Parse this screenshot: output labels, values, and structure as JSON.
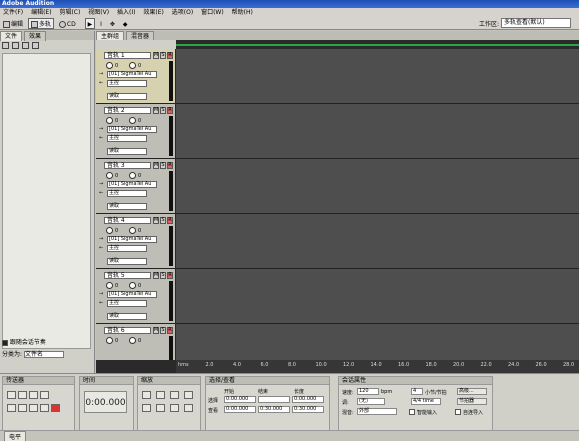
{
  "app": {
    "title": "Adobe Audition"
  },
  "menu": [
    "文件(F)",
    "编辑(E)",
    "剪辑(C)",
    "视图(V)",
    "插入(I)",
    "效果(E)",
    "选项(O)",
    "窗口(W)",
    "帮助(H)"
  ],
  "toolbar": {
    "edit": "编辑",
    "multitrack": "多轨",
    "cd": "CD",
    "workspace_label": "工作区:",
    "workspace_value": "多轨查看(默认)"
  },
  "left_tabs": [
    "文件",
    "效果"
  ],
  "left_footer": {
    "follow_label": "跟随会话节奏",
    "sortby_label": "分类为:",
    "sortby_value": "文件名"
  },
  "main_tabs": [
    "主群组",
    "混音器"
  ],
  "tracks": [
    {
      "name": "音轨 1",
      "vol": "0",
      "pan": "0",
      "input": "[01] SigmaTel Au",
      "output": "主控",
      "mode": "读取"
    },
    {
      "name": "音轨 2",
      "vol": "0",
      "pan": "0",
      "input": "[01] SigmaTel Au",
      "output": "主控",
      "mode": "读取"
    },
    {
      "name": "音轨 3",
      "vol": "0",
      "pan": "0",
      "input": "[01] SigmaTel Au",
      "output": "主控",
      "mode": "读取"
    },
    {
      "name": "音轨 4",
      "vol": "0",
      "pan": "0",
      "input": "[01] SigmaTel Au",
      "output": "主控",
      "mode": "读取"
    },
    {
      "name": "音轨 5",
      "vol": "0",
      "pan": "0",
      "input": "[01] SigmaTel Au",
      "output": "主控",
      "mode": "读取"
    },
    {
      "name": "音轨 6",
      "vol": "0",
      "pan": "0"
    }
  ],
  "ruler": [
    "hms",
    "2.0",
    "4.0",
    "6.0",
    "8.0",
    "10.0",
    "12.0",
    "14.0",
    "16.0",
    "18.0",
    "20.0",
    "22.0",
    "24.0",
    "26.0",
    "28.0"
  ],
  "transport": {
    "title": "传送器"
  },
  "time": {
    "title": "时间",
    "value": "0:00.000"
  },
  "zoom": {
    "title": "缩放"
  },
  "selection": {
    "title": "选择/查看",
    "col_start": "开始",
    "col_end": "结束",
    "col_length": "长度",
    "row_select": "选择",
    "row_view": "查看",
    "sel_start": "0:00.000",
    "sel_end": "",
    "sel_len": "0:00.000",
    "view_start": "0:00.000",
    "view_end": "0:30.000",
    "view_len": "0:30.000"
  },
  "session": {
    "title": "会话属性",
    "tempo_label": "速度:",
    "tempo": "120",
    "bpm": "bpm",
    "beats": "4",
    "beats_unit": "小节/节拍",
    "advanced": "高级...",
    "key_label": "调:",
    "key": "(无)",
    "time_sig": "4/4 time",
    "metronome": "节拍器",
    "mono_label": "混音:",
    "mono": "外部",
    "smart_label": "智能输入",
    "auto_label": "自连导入"
  },
  "status": {
    "tab": "电平"
  }
}
